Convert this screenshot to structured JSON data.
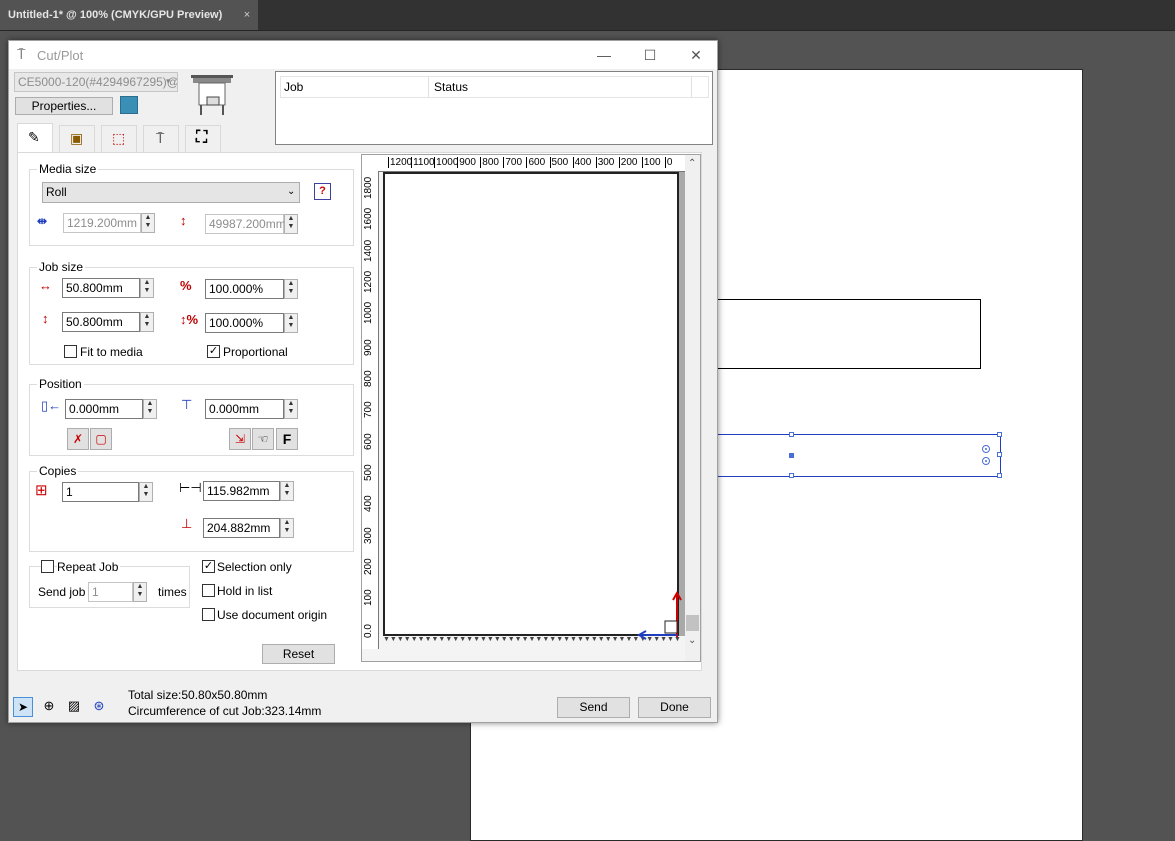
{
  "app": {
    "document_tab": "Untitled-1* @ 100% (CMYK/GPU Preview)",
    "document_tab_close": "×"
  },
  "dialog": {
    "title": "Cut/Plot",
    "window_buttons": {
      "minimize": "—",
      "maximize": "☐",
      "close": "✕"
    },
    "device": {
      "selected": "CE5000-120(#4294967295)@",
      "properties_label": "Properties..."
    },
    "job_table": {
      "columns": [
        "Job",
        "Status"
      ],
      "rows": []
    },
    "tabs": [
      "general-tab",
      "plotter-tab",
      "registration-tab",
      "tool-tab",
      "fullscreen-tab"
    ],
    "media_size": {
      "label": "Media size",
      "type": "Roll",
      "width": "1219.200mm",
      "length": "49987.200mm"
    },
    "job_size": {
      "label": "Job size",
      "width": "50.800mm",
      "height": "50.800mm",
      "scale_x": "100.000%",
      "scale_y": "100.000%",
      "fit_to_media": {
        "label": "Fit to media",
        "checked": false
      },
      "proportional": {
        "label": "Proportional",
        "checked": true
      }
    },
    "position": {
      "label": "Position",
      "x": "0.000mm",
      "y": "0.000mm",
      "f_button": "F"
    },
    "copies": {
      "label": "Copies",
      "count": "1",
      "spacing_x": "115.982mm",
      "spacing_y": "204.882mm"
    },
    "repeat_job": {
      "label": "Repeat Job",
      "checked": false,
      "send_job_label": "Send job",
      "times_value": "1",
      "times_label": "times"
    },
    "options": {
      "selection_only": {
        "label": "Selection only",
        "checked": true
      },
      "hold_in_list": {
        "label": "Hold in list",
        "checked": false
      },
      "use_document_origin": {
        "label": "Use document origin",
        "checked": false
      }
    },
    "reset_label": "Reset",
    "preview": {
      "top_ruler": [
        "1200",
        "1100",
        "1000",
        "900",
        "800",
        "700",
        "600",
        "500",
        "400",
        "300",
        "200",
        "100",
        "0"
      ],
      "side_ruler": [
        "1800",
        "1600",
        "1400",
        "1200",
        "1000",
        "900",
        "800",
        "700",
        "600",
        "500",
        "400",
        "300",
        "200",
        "100",
        "0.0"
      ]
    },
    "status": {
      "total_size": "Total size:50.80x50.80mm",
      "circumference": "Circumference of cut Job:323.14mm"
    },
    "send_label": "Send",
    "done_label": "Done"
  }
}
